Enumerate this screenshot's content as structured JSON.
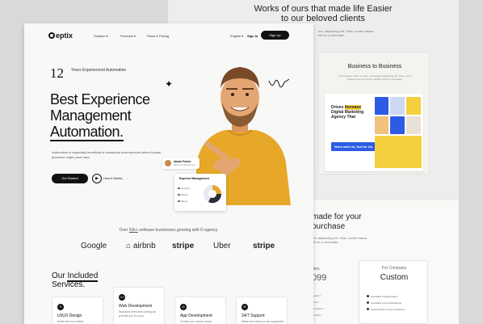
{
  "back_page": {
    "title_line1": "Works of ours that made life Easier",
    "title_line2": "to our beloved clients",
    "title_hint": "ent. adipiscing elit. Vitae, morbi massa elit ac a venenatis.",
    "b2b_title": "Business to Business",
    "b2b_sub": "Tincunt ipsum dolor sit amet, consectetur adipiscing elit. Vitae, morbi massa purus fermentum facilisis elit ac a venenatis.",
    "agency_text_pre": "Drives ",
    "agency_text_hl": "Increase",
    "agency_text_post": " Digital Marketing Agency That",
    "work_with": "Work with Us, Not for Us.",
    "purchase_title_1": "made for your",
    "purchase_title_2": "ourchase",
    "purchase_hint": "ent. adipiscing elit. Vitae, morbi massa elit ac a venenatis.",
    "price_label": "vers",
    "price_value": "099",
    "left_features": [
      "legration",
      "ization",
      "munication",
      "dification"
    ],
    "plan_for": "For Company",
    "plan_name": "Custom",
    "plan_features": [
      "Feedback Categorization",
      "Feedback Loop Notifications",
      "Essential Bee Tools integrations"
    ]
  },
  "header": {
    "logo": "eptix",
    "nav": [
      "Solution",
      "Products",
      "Plans & Pricing"
    ],
    "language": "English",
    "signin": "Sign In",
    "signup": "Sign Up"
  },
  "hero": {
    "years_num": "12",
    "years_label": "Years Experienced Automation",
    "headline_1": "Best Experience",
    "headline_2": "Management",
    "headline_3": "Automation.",
    "lead": "Automation is especially beneficial in hazardous environments where human presence might pose risks.",
    "cta_primary": "Get Started",
    "cta_secondary": "How it Works",
    "name_tag": "alsam Fonds",
    "name_tag_sub": "Bussiness Management",
    "dash_title": "Expense Management",
    "dash_rows": [
      "Account",
      "Works",
      "Memo"
    ]
  },
  "trust": {
    "pre": "Over ",
    "highlight": "53k+",
    "post": " software businesses growing with D-agency.",
    "brands": [
      "Google",
      "airbnb",
      "stripe",
      "Uber",
      "stripe"
    ]
  },
  "services": {
    "title_1": "Our",
    "title_hl": "Included",
    "title_2": "Services.",
    "cards": [
      {
        "name": "UI/UX Design",
        "desc": "Morbi nisi et a sollicit"
      },
      {
        "name": "Web Development",
        "desc": "Standard went and coding we provide you for your"
      },
      {
        "name": "App Development",
        "desc": "Create your visual voices"
      },
      {
        "name": "24/7 Support",
        "desc": "Make sure that you are supported"
      }
    ]
  },
  "colors": {
    "accent": "#f4d03f",
    "dark": "#111111",
    "shirt": "#e7a82a",
    "blue": "#2d5be3"
  }
}
